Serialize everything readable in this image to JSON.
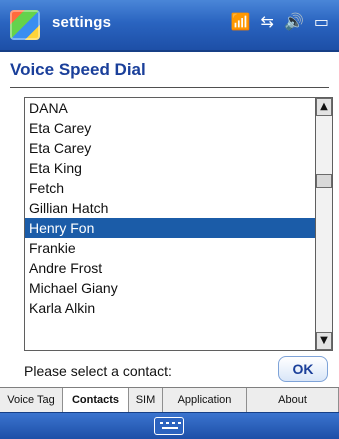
{
  "titlebar": {
    "title": "settings",
    "icons": [
      "windows-start-icon",
      "signal-icon",
      "network-icon",
      "volume-icon",
      "battery-icon"
    ]
  },
  "header": {
    "title": "Voice Speed Dial"
  },
  "contacts": {
    "items": [
      "DANA",
      "Eta Carey",
      "Eta Carey",
      "Eta King",
      "Fetch",
      "Gillian Hatch",
      "Henry Fon",
      "Frankie",
      "Andre Frost",
      "Michael Giany",
      "Karla Alkin",
      ""
    ],
    "selected_index": 6
  },
  "prompt": {
    "text": "Please select a contact:",
    "ok_label": "OK"
  },
  "tabs": [
    {
      "label": "Voice Tag"
    },
    {
      "label": "Contacts",
      "active": true
    },
    {
      "label": "SIM"
    },
    {
      "label": "Application"
    },
    {
      "label": "About"
    }
  ],
  "colors": {
    "titlebar": "#2a64c0",
    "header_text": "#1a3f9a",
    "selection": "#1b5ca8"
  }
}
